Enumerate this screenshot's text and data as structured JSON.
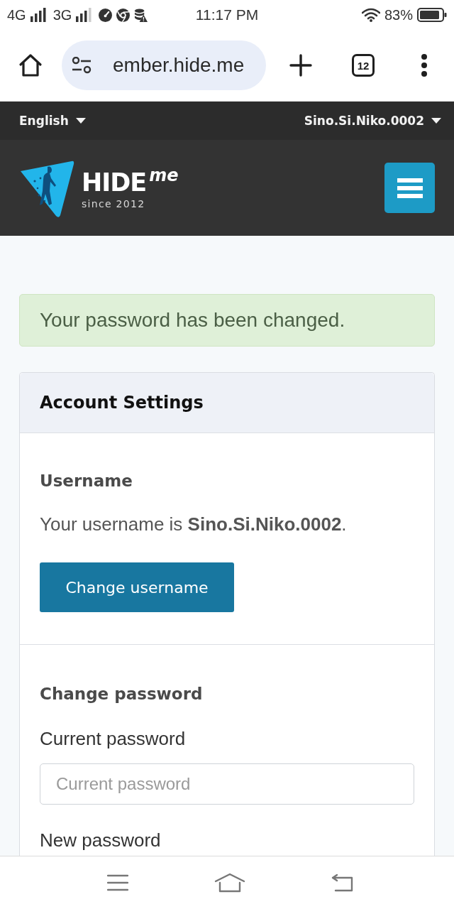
{
  "status_bar": {
    "network_1": "4G",
    "network_2": "3G",
    "time": "11:17 PM",
    "battery": "83%"
  },
  "browser_toolbar": {
    "url": "ember.hide.me",
    "tab_count": "12"
  },
  "top_bar": {
    "language": "English",
    "account": "Sino.Si.Niko.0002"
  },
  "header": {
    "logo": {
      "name": "HIDE",
      "suffix": "me",
      "tagline": "since 2012"
    }
  },
  "alert": {
    "kind": "success",
    "message": "Your password has been changed."
  },
  "account_settings": {
    "title": "Account Settings",
    "sections": [
      {
        "kind": "username",
        "title": "Username",
        "text": "Your username is **Sino.Si.Niko.0002**.",
        "button": "Change username"
      },
      {
        "kind": "password",
        "title": "Change password",
        "fields": [
          {
            "label": "Current password",
            "placeholder": "Current password"
          },
          {
            "label": "New password"
          }
        ]
      }
    ]
  }
}
